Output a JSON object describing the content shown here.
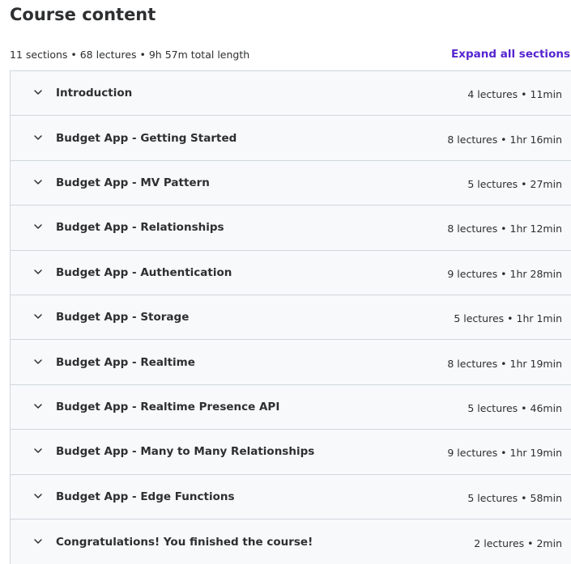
{
  "header": {
    "title": "Course content",
    "summary": "11 sections • 68 lectures • 9h 57m total length",
    "expand_label": "Expand all sections"
  },
  "sections": [
    {
      "title": "Introduction",
      "meta": "4 lectures • 11min"
    },
    {
      "title": "Budget App - Getting Started",
      "meta": "8 lectures • 1hr 16min"
    },
    {
      "title": "Budget App - MV Pattern",
      "meta": "5 lectures • 27min"
    },
    {
      "title": "Budget App - Relationships",
      "meta": "8 lectures • 1hr 12min"
    },
    {
      "title": "Budget App - Authentication",
      "meta": "9 lectures • 1hr 28min"
    },
    {
      "title": "Budget App - Storage",
      "meta": "5 lectures • 1hr 1min"
    },
    {
      "title": "Budget App - Realtime",
      "meta": "8 lectures • 1hr 19min"
    },
    {
      "title": "Budget App - Realtime Presence API",
      "meta": "5 lectures • 46min"
    },
    {
      "title": "Budget App - Many to Many Relationships",
      "meta": "9 lectures • 1hr 19min"
    },
    {
      "title": "Budget App - Edge Functions",
      "meta": "5 lectures • 58min"
    },
    {
      "title": "Congratulations! You finished the course!",
      "meta": "2 lectures • 2min"
    }
  ],
  "icons": {
    "section_toggle": "chevron-down-icon"
  },
  "colors": {
    "accent": "#5624d0",
    "row_background": "#f7f9fa",
    "border": "#d1d7dc",
    "text": "#2d2f31"
  }
}
